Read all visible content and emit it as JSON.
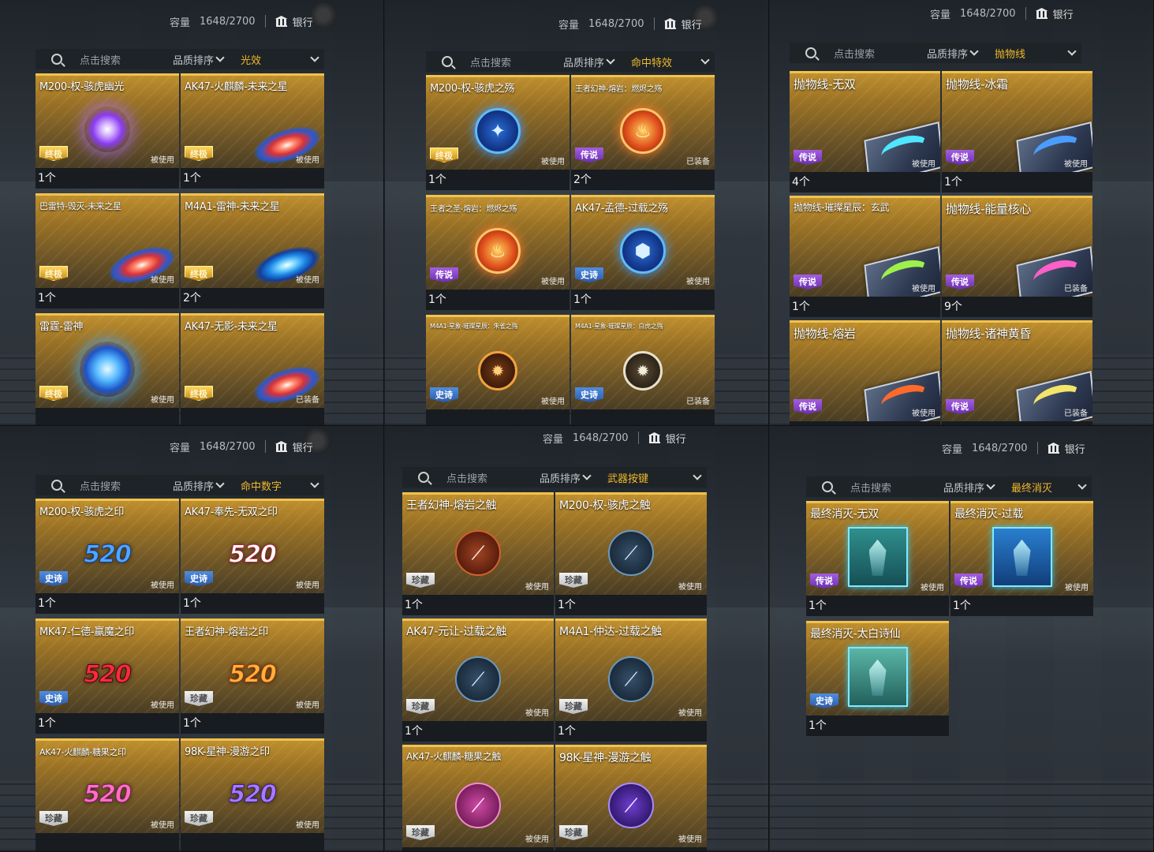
{
  "common": {
    "capacity_label": "容量",
    "capacity_value": "1648/2700",
    "bank_label": "银行",
    "search_placeholder": "点击搜索",
    "sort_label": "品质排序"
  },
  "panels": [
    {
      "filter": "光效",
      "items": [
        {
          "name": "M200-权-骇虎幽光",
          "badge": "终极",
          "status": "被使用",
          "count": "1个"
        },
        {
          "name": "AK47-火麒麟-未来之星",
          "badge": "终极",
          "status": "被使用",
          "count": "1个"
        },
        {
          "name": "巴雷特-毁灭-未来之星",
          "badge": "终极",
          "status": "被使用",
          "count": "1个"
        },
        {
          "name": "M4A1-雷神-未来之星",
          "badge": "终极",
          "status": "被使用",
          "count": "2个"
        },
        {
          "name": "雷霆-雷神",
          "badge": "终极",
          "status": "被使用",
          "count": ""
        },
        {
          "name": "AK47-无影-未来之星",
          "badge": "终极",
          "status": "已装备",
          "count": ""
        }
      ]
    },
    {
      "filter": "命中特效",
      "items": [
        {
          "name": "M200-权-骇虎之殇",
          "badge": "终极",
          "status": "被使用",
          "count": "1个"
        },
        {
          "name": "王者幻神-熔岩：燃烬之殇",
          "badge": "传说",
          "status": "已装备",
          "count": "2个"
        },
        {
          "name": "王者之圣-熔岩：燃烬之殇",
          "badge": "传说",
          "status": "被使用",
          "count": "1个"
        },
        {
          "name": "AK47-孟德-过载之殇",
          "badge": "史诗",
          "status": "被使用",
          "count": "1个"
        },
        {
          "name": "M4A1-星象-璀璨星辰：朱雀之殇",
          "badge": "史诗",
          "status": "被使用",
          "count": ""
        },
        {
          "name": "M4A1-星象-璀璨星辰：白虎之殇",
          "badge": "史诗",
          "status": "已装备",
          "count": ""
        }
      ]
    },
    {
      "filter": "抛物线",
      "items": [
        {
          "name": "抛物线-无双",
          "badge": "传说",
          "status": "被使用",
          "count": "4个"
        },
        {
          "name": "抛物线-冰霜",
          "badge": "传说",
          "status": "被使用",
          "count": "1个"
        },
        {
          "name": "抛物线-璀璨星辰：玄武",
          "badge": "传说",
          "status": "被使用",
          "count": "1个"
        },
        {
          "name": "抛物线-能量核心",
          "badge": "传说",
          "status": "已装备",
          "count": "9个"
        },
        {
          "name": "抛物线-熔岩",
          "badge": "传说",
          "status": "被使用",
          "count": ""
        },
        {
          "name": "抛物线-诸神黄昏",
          "badge": "传说",
          "status": "已装备",
          "count": ""
        }
      ]
    },
    {
      "filter": "命中数字",
      "items": [
        {
          "name": "M200-权-骇虎之印",
          "badge": "史诗",
          "status": "被使用",
          "count": "1个",
          "art_text": "520"
        },
        {
          "name": "AK47-奉先-无双之印",
          "badge": "史诗",
          "status": "被使用",
          "count": "1个",
          "art_text": "520"
        },
        {
          "name": "MK47-仁德-赢魔之印",
          "badge": "史诗",
          "status": "被使用",
          "count": "1个",
          "art_text": "520"
        },
        {
          "name": "王者幻神-熔岩之印",
          "badge": "珍藏",
          "status": "被使用",
          "count": "1个",
          "art_text": "520"
        },
        {
          "name": "AK47-火麒麟-糖果之印",
          "badge": "珍藏",
          "status": "被使用",
          "count": "",
          "art_text": "520"
        },
        {
          "name": "98K-星神-漫游之印",
          "badge": "珍藏",
          "status": "被使用",
          "count": "",
          "art_text": "520"
        }
      ]
    },
    {
      "filter": "武器按键",
      "items": [
        {
          "name": "王者幻神-熔岩之触",
          "badge": "珍藏",
          "status": "被使用",
          "count": "1个"
        },
        {
          "name": "M200-权-骇虎之触",
          "badge": "珍藏",
          "status": "被使用",
          "count": "1个"
        },
        {
          "name": "AK47-元让-过载之触",
          "badge": "珍藏",
          "status": "被使用",
          "count": "1个"
        },
        {
          "name": "M4A1-仲达-过载之触",
          "badge": "珍藏",
          "status": "被使用",
          "count": "1个"
        },
        {
          "name": "AK47-火麒麟-糖果之触",
          "badge": "珍藏",
          "status": "被使用",
          "count": ""
        },
        {
          "name": "98K-星神-漫游之触",
          "badge": "珍藏",
          "status": "被使用",
          "count": ""
        }
      ]
    },
    {
      "filter": "最终消灭",
      "items": [
        {
          "name": "最终消灭-无双",
          "badge": "传说",
          "status": "被使用",
          "count": "1个"
        },
        {
          "name": "最终消灭-过载",
          "badge": "传说",
          "status": "被使用",
          "count": "1个"
        },
        {
          "name": "最终消灭-太白诗仙",
          "badge": "史诗",
          "status": "",
          "count": "1个"
        }
      ]
    }
  ]
}
